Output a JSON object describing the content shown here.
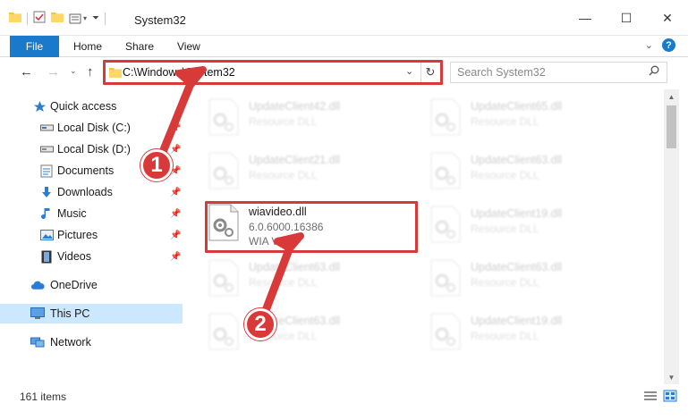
{
  "window": {
    "title": "System32",
    "minimize": "—",
    "maximize": "☐",
    "close": "✕"
  },
  "ribbon": {
    "file_tab": "File",
    "tabs": [
      "Home",
      "Share",
      "View"
    ],
    "help": "?"
  },
  "address_bar": {
    "path": "C:\\Windows\\System32",
    "search_placeholder": "Search System32"
  },
  "sidebar": {
    "items": [
      {
        "label": "Quick access",
        "icon": "star-icon",
        "pinned": false
      },
      {
        "label": "Local Disk (C:)",
        "icon": "drive-icon",
        "pinned": true
      },
      {
        "label": "Local Disk (D:)",
        "icon": "drive-icon",
        "pinned": true
      },
      {
        "label": "Documents",
        "icon": "documents-icon",
        "pinned": true
      },
      {
        "label": "Downloads",
        "icon": "downloads-icon",
        "pinned": true
      },
      {
        "label": "Music",
        "icon": "music-icon",
        "pinned": true
      },
      {
        "label": "Pictures",
        "icon": "pictures-icon",
        "pinned": true
      },
      {
        "label": "Videos",
        "icon": "videos-icon",
        "pinned": true
      },
      {
        "label": "OneDrive",
        "icon": "onedrive-icon",
        "pinned": false
      },
      {
        "label": "This PC",
        "icon": "this-pc-icon",
        "pinned": false,
        "selected": true
      },
      {
        "label": "Network",
        "icon": "network-icon",
        "pinned": false
      }
    ]
  },
  "files": [
    {
      "name": "UpdateClient42.dll",
      "line2": "Resource DLL",
      "line3": "",
      "faded": true
    },
    {
      "name": "UpdateClient65.dll",
      "line2": "Resource DLL",
      "line3": "",
      "faded": true
    },
    {
      "name": "UpdateClient21.dll",
      "line2": "Resource DLL",
      "line3": "",
      "faded": true
    },
    {
      "name": "UpdateClient63.dll",
      "line2": "Resource DLL",
      "line3": "",
      "faded": true
    },
    {
      "name": "wiavideo.dll",
      "line2": "6.0.6000.16386",
      "line3": "WIA Video",
      "faded": false
    },
    {
      "name": "UpdateClient19.dll",
      "line2": "Resource DLL",
      "line3": "",
      "faded": true
    },
    {
      "name": "UpdateClient63.dll",
      "line2": "Resource DLL",
      "line3": "",
      "faded": true
    },
    {
      "name": "UpdateClient63.dll",
      "line2": "Resource DLL",
      "line3": "",
      "faded": true
    },
    {
      "name": "UpdateClient63.dll",
      "line2": "Resource DLL",
      "line3": "",
      "faded": true
    },
    {
      "name": "UpdateClient19.dll",
      "line2": "Resource DLL",
      "line3": "",
      "faded": true
    }
  ],
  "status": {
    "item_count": "161 items"
  },
  "annotations": {
    "step1": "1",
    "step2": "2",
    "highlight_color": "#d83a3a"
  },
  "colors": {
    "accent": "#1979ca",
    "selection": "#cce8ff"
  }
}
